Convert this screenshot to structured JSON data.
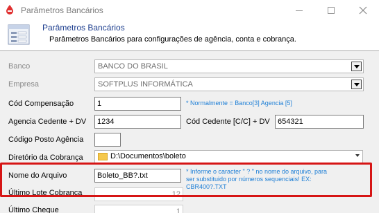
{
  "window": {
    "title": "Parâmetros Bancários",
    "colors": {
      "title_text": "#7a7a7a",
      "header_title": "#1e3f8f",
      "note": "#1e7fd6",
      "highlight": "#d61515"
    }
  },
  "header": {
    "title": "Parâmetros Bancários",
    "subtitle": "Parâmetros Bancários para configurações de agência, conta e cobrança."
  },
  "form": {
    "banco": {
      "label": "Banco",
      "value": "BANCO DO BRASIL"
    },
    "empresa": {
      "label": "Empresa",
      "value": "SOFTPLUS INFORMÁTICA"
    },
    "cod_compensacao": {
      "label": "Cód Compensação",
      "value": "1",
      "note": "* Normalmente  = Banco[3] Agencia [5]"
    },
    "agencia_cedente": {
      "label": "Agencia Cedente + DV",
      "value": "1234"
    },
    "cod_cedente": {
      "label": "Cód Cedente [C/C] + DV",
      "value": "654321"
    },
    "codigo_posto": {
      "label": "Código Posto Agência",
      "value": ""
    },
    "diretorio": {
      "label": "Diretório da Cobrança",
      "value": "D:\\Documentos\\boleto"
    },
    "nome_arquivo": {
      "label": "Nome do Arquivo",
      "value": "Boleto_BB?.txt",
      "note_line1": "* Informe o caracter \" ? \" no nome do arquivo, para",
      "note_line2": "ser substituido por números sequenciais! EX:",
      "note_line3": "CBR400?.TXT"
    },
    "ultimo_lote": {
      "label": "Último Lote Cobrança",
      "value": "12"
    },
    "ultimo_cheque": {
      "label": "Último Cheque",
      "value": "1"
    }
  }
}
